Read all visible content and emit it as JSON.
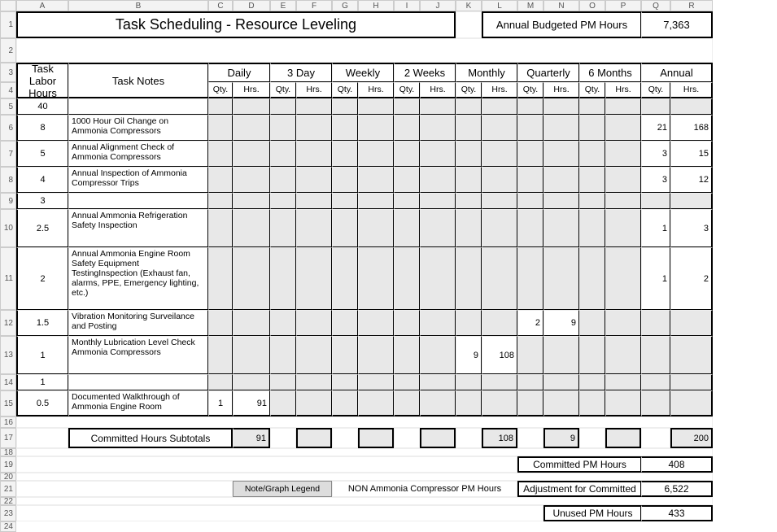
{
  "col_letters": [
    "A",
    "B",
    "C",
    "D",
    "E",
    "F",
    "G",
    "H",
    "I",
    "J",
    "K",
    "L",
    "M",
    "N",
    "O",
    "P",
    "Q",
    "R"
  ],
  "row_numbers": [
    "1",
    "2",
    "3",
    "4",
    "5",
    "6",
    "7",
    "8",
    "9",
    "10",
    "11",
    "12",
    "13",
    "14",
    "15",
    "16",
    "17",
    "18",
    "19",
    "20",
    "21",
    "22",
    "23",
    "24"
  ],
  "title": "Task Scheduling - Resource Leveling",
  "budget_label": "Annual  Budgeted PM Hours",
  "budget_value": "7,363",
  "hdr_task_labor_hours": "Task\nLabor\nHours",
  "hdr_task_notes": "Task Notes",
  "periods": [
    "Daily",
    "3 Day",
    "Weekly",
    "2 Weeks",
    "Monthly",
    "Quarterly",
    "6 Months",
    "Annual"
  ],
  "qty": "Qty.",
  "hrs": "Hrs.",
  "rows": [
    {
      "hours": "40",
      "note": ""
    },
    {
      "hours": "8",
      "note": "1000 Hour Oil Change on Ammonia Compressors",
      "annual_qty": "21",
      "annual_hrs": "168"
    },
    {
      "hours": "5",
      "note": "Annual Alignment Check of Ammonia Compressors",
      "annual_qty": "3",
      "annual_hrs": "15"
    },
    {
      "hours": "4",
      "note": "Annual Inspection of Ammonia Compressor Trips",
      "annual_qty": "3",
      "annual_hrs": "12"
    },
    {
      "hours": "3",
      "note": ""
    },
    {
      "hours": "2.5",
      "note": "Annual Ammonia Refrigeration Safety Inspection",
      "annual_qty": "1",
      "annual_hrs": "3"
    },
    {
      "hours": "2",
      "note": "Annual Ammonia Engine Room Safety Equipment TestingInspection (Exhaust fan, alarms, PPE, Emergency lighting, etc.)",
      "annual_qty": "1",
      "annual_hrs": "2"
    },
    {
      "hours": "1.5",
      "note": "Vibration Monitoring Surveilance and Posting",
      "quarterly_qty": "2",
      "quarterly_hrs": "9"
    },
    {
      "hours": "1",
      "note": "Monthly Lubrication Level Check Ammonia Compressors",
      "monthly_qty": "9",
      "monthly_hrs": "108"
    },
    {
      "hours": "1",
      "note": ""
    },
    {
      "hours": "0.5",
      "note": "Documented Walkthrough of Ammonia Engine Room",
      "daily_qty": "1",
      "daily_hrs": "91"
    }
  ],
  "subtotal_label": "Committed Hours Subtotals",
  "subtotals": {
    "daily": "91",
    "threeday": "",
    "weekly": "",
    "twoweeks": "",
    "monthly": "108",
    "quarterly": "9",
    "sixmonths": "",
    "annual": "200"
  },
  "committed_label": "Committed PM Hours",
  "committed_value": "408",
  "legend_label": "Note/Graph Legend",
  "legend_text": "NON Ammonia Compressor PM Hours",
  "adjustment_label": "Adjustment for Committed",
  "adjustment_value": "6,522",
  "unused_label": "Unused PM Hours",
  "unused_value": "433"
}
